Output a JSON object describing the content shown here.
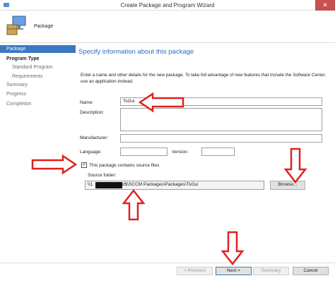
{
  "window": {
    "title": "Create Package and Program Wizard",
    "close_glyph": "✕"
  },
  "header": {
    "label": "Package"
  },
  "sidebar": {
    "items": [
      {
        "label": "Package"
      },
      {
        "label": "Program Type"
      },
      {
        "label": "Standard Program"
      },
      {
        "label": "Requirements"
      },
      {
        "label": "Summary"
      },
      {
        "label": "Progress"
      },
      {
        "label": "Completion"
      }
    ]
  },
  "main": {
    "title": "Specify information about this package",
    "intro": "Enter a name and other details for the new package. To take full advantage of new features that include the Software Center, use an application instead.",
    "name_label": "Name:",
    "name_value": "TsGui",
    "description_label": "Description:",
    "description_value": "",
    "manufacturer_label": "Manufacturer:",
    "manufacturer_value": "",
    "language_label": "Language:",
    "language_value": "",
    "version_label": "Version:",
    "version_value": "",
    "contains_source_label": "This package contains source files",
    "contains_source_checked": "✓",
    "source_folder_label": "Source folder:",
    "source_prefix": "\\\\1",
    "source_suffix": "\\d$\\SCCM Packages\\Packages\\TsGui",
    "browse_label": "Browse..."
  },
  "footer": {
    "previous_label": "< Previous",
    "next_label": "Next >",
    "summary_label": "Summary",
    "cancel_label": "Cancel"
  },
  "colors": {
    "accent": "#3a78c2",
    "title_blue": "#2a6bbf",
    "annotation_red": "#e02020",
    "close_red": "#c75050"
  }
}
